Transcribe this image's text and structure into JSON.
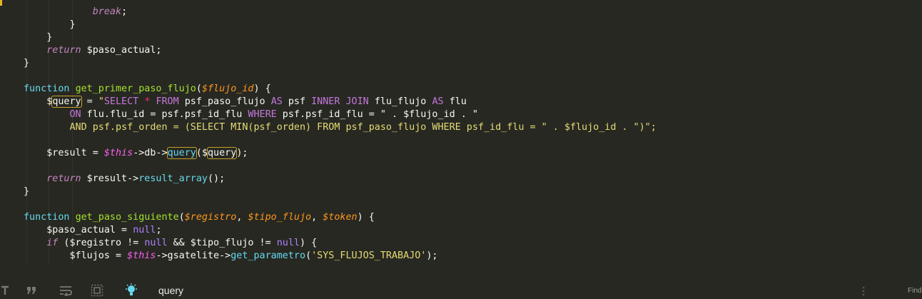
{
  "code_lines": [
    {
      "indent": "            ",
      "tokens": [
        {
          "c": "kw-ret2",
          "t": "break"
        },
        {
          "c": "plain",
          "t": ";"
        }
      ]
    },
    {
      "indent": "        ",
      "tokens": [
        {
          "c": "plain",
          "t": "}"
        }
      ]
    },
    {
      "indent": "    ",
      "tokens": [
        {
          "c": "plain",
          "t": "}"
        }
      ]
    },
    {
      "indent": "    ",
      "tokens": [
        {
          "c": "kw-ret2",
          "t": "return"
        },
        {
          "c": "plain",
          "t": " $paso_actual;"
        }
      ]
    },
    {
      "indent": "",
      "tokens": [
        {
          "c": "plain",
          "t": "}"
        }
      ]
    },
    {
      "indent": "",
      "tokens": []
    },
    {
      "indent": "",
      "tokens": [
        {
          "c": "kw-fn",
          "t": "function"
        },
        {
          "c": "plain",
          "t": " "
        },
        {
          "c": "fn",
          "t": "get_primer_paso_flujo"
        },
        {
          "c": "plain",
          "t": "("
        },
        {
          "c": "param",
          "t": "$flujo_id"
        },
        {
          "c": "plain",
          "t": ") {"
        }
      ]
    },
    {
      "indent": "    ",
      "tokens": [
        {
          "c": "plain",
          "t": "$"
        },
        {
          "c": "plain highlight",
          "t": "query"
        },
        {
          "c": "plain",
          "t": " = "
        },
        {
          "c": "strtext",
          "t": "\""
        },
        {
          "c": "sqlkw",
          "t": "SELECT"
        },
        {
          "c": "strtext",
          "t": " "
        },
        {
          "c": "kw-ctl",
          "t": "*"
        },
        {
          "c": "strtext",
          "t": " "
        },
        {
          "c": "sqlkw",
          "t": "FROM"
        },
        {
          "c": "plain",
          "t": " psf_paso_flujo "
        },
        {
          "c": "sqlkw",
          "t": "AS"
        },
        {
          "c": "plain",
          "t": " psf "
        },
        {
          "c": "sqlkw",
          "t": "INNER JOIN"
        },
        {
          "c": "plain",
          "t": " flu_flujo "
        },
        {
          "c": "sqlkw",
          "t": "AS"
        },
        {
          "c": "plain",
          "t": " flu"
        }
      ]
    },
    {
      "indent": "        ",
      "tokens": [
        {
          "c": "sqlkw",
          "t": "ON"
        },
        {
          "c": "plain",
          "t": " flu.flu_id = psf.psf_id_flu "
        },
        {
          "c": "sqlkw",
          "t": "WHERE"
        },
        {
          "c": "plain",
          "t": " psf.psf_id_flu = \" . $flujo_id . \""
        }
      ]
    },
    {
      "indent": "        ",
      "tokens": [
        {
          "c": "str",
          "t": "AND psf.psf_orden = (SELECT MIN(psf_orden) FROM psf_paso_flujo WHERE psf_id_flu = \" . $flujo_id . \")\";"
        }
      ]
    },
    {
      "indent": "",
      "tokens": []
    },
    {
      "indent": "    ",
      "tokens": [
        {
          "c": "plain",
          "t": "$result = "
        },
        {
          "c": "this",
          "t": "$this"
        },
        {
          "c": "plain",
          "t": "->db->"
        },
        {
          "c": "method highlight",
          "t": "query"
        },
        {
          "c": "plain",
          "t": "($"
        },
        {
          "c": "plain highlight",
          "t": "query"
        },
        {
          "c": "plain",
          "t": ");"
        }
      ]
    },
    {
      "indent": "",
      "tokens": []
    },
    {
      "indent": "    ",
      "tokens": [
        {
          "c": "kw-ret2",
          "t": "return"
        },
        {
          "c": "plain",
          "t": " $result->"
        },
        {
          "c": "method",
          "t": "result_array"
        },
        {
          "c": "plain",
          "t": "();"
        }
      ]
    },
    {
      "indent": "",
      "tokens": [
        {
          "c": "plain",
          "t": "}"
        }
      ]
    },
    {
      "indent": "",
      "tokens": []
    },
    {
      "indent": "",
      "tokens": [
        {
          "c": "kw-fn",
          "t": "function"
        },
        {
          "c": "plain",
          "t": " "
        },
        {
          "c": "fn",
          "t": "get_paso_siguiente"
        },
        {
          "c": "plain",
          "t": "("
        },
        {
          "c": "param",
          "t": "$registro"
        },
        {
          "c": "plain",
          "t": ", "
        },
        {
          "c": "param",
          "t": "$tipo_flujo"
        },
        {
          "c": "plain",
          "t": ", "
        },
        {
          "c": "param",
          "t": "$token"
        },
        {
          "c": "plain",
          "t": ") {"
        }
      ]
    },
    {
      "indent": "    ",
      "tokens": [
        {
          "c": "plain",
          "t": "$paso_actual = "
        },
        {
          "c": "null",
          "t": "null"
        },
        {
          "c": "plain",
          "t": ";"
        }
      ]
    },
    {
      "indent": "    ",
      "tokens": [
        {
          "c": "kw-ret2",
          "t": "if"
        },
        {
          "c": "plain",
          "t": " ($registro != "
        },
        {
          "c": "null",
          "t": "null"
        },
        {
          "c": "plain",
          "t": " && $tipo_flujo != "
        },
        {
          "c": "null",
          "t": "null"
        },
        {
          "c": "plain",
          "t": ") {"
        }
      ]
    },
    {
      "indent": "        ",
      "tokens": [
        {
          "c": "plain",
          "t": "$flujos = "
        },
        {
          "c": "this",
          "t": "$this"
        },
        {
          "c": "plain",
          "t": "->gsatelite->"
        },
        {
          "c": "method",
          "t": "get_parametro"
        },
        {
          "c": "plain",
          "t": "("
        },
        {
          "c": "str",
          "t": "'SYS_FLUJOS_TRABAJO'"
        },
        {
          "c": "plain",
          "t": ");"
        }
      ]
    }
  ],
  "statusbar": {
    "search_term": "query",
    "find_label": "Find",
    "icons": [
      "case-sensitive-icon",
      "quote-icon",
      "wrap-icon",
      "in-selection-icon",
      "highlight-matches-icon"
    ]
  },
  "colors": {
    "background": "#272822",
    "keyword": "#66d9ef",
    "function": "#a6e22e",
    "string": "#e6db74",
    "parameter": "#fd971f",
    "sql_keyword": "#c678dd",
    "highlight_border": "#c9a227"
  }
}
